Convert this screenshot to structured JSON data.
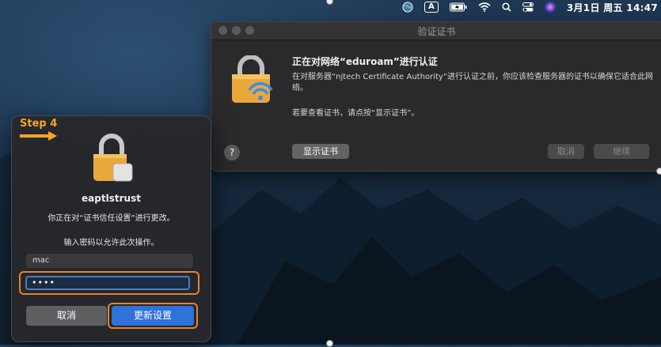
{
  "menubar": {
    "input_indicator": "A",
    "datetime": "3月1日 周五  14:47",
    "icons": [
      "globe-icon",
      "input-source-icon",
      "battery-icon",
      "wifi-icon",
      "search-icon",
      "control-center-icon",
      "siri-icon"
    ]
  },
  "cert_window": {
    "title": "验证证书",
    "heading": "正在对网络“eduroam”进行认证",
    "body": "在对服务器“njtech Certificate Authority”进行认证之前，你应该检查服务器的证书以确保它适合此网络。",
    "body2": "若要查看证书，请点按“显示证书”。",
    "help_label": "?",
    "show_cert_label": "显示证书",
    "cancel_label": "取消",
    "continue_label": "继续"
  },
  "auth_dialog": {
    "step_label": "Step 4",
    "app_name": "eaptlstrust",
    "message": "你正在对“证书信任设置”进行更改。",
    "prompt": "输入密码以允许此次操作。",
    "username_value": "mac",
    "password_value": "••••",
    "cancel_label": "取消",
    "update_label": "更新设置"
  },
  "colors": {
    "highlight": "#e8822e",
    "primary_button": "#2f72d9",
    "step_text": "#f5a623"
  }
}
